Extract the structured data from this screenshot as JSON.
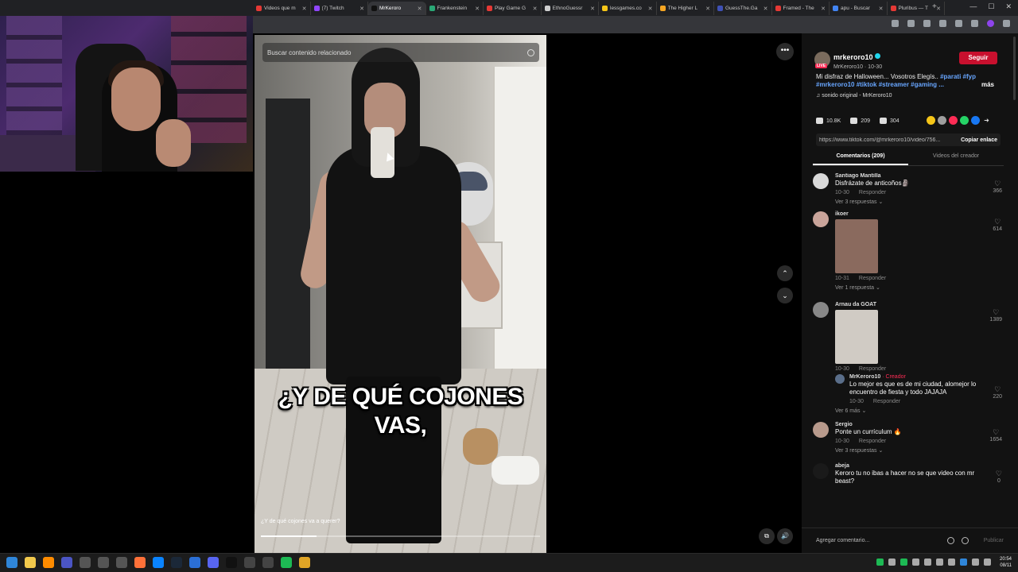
{
  "browser": {
    "tabs": [
      {
        "title": "Videos que m",
        "color": "#e53935"
      },
      {
        "title": "(7) Twitch",
        "color": "#9146ff"
      },
      {
        "title": "MrKeroro",
        "color": "#111111",
        "active": true
      },
      {
        "title": "Frankenstein",
        "color": "#2aa876"
      },
      {
        "title": "Play Game G",
        "color": "#e53935"
      },
      {
        "title": "EthnoGuessr",
        "color": "#cfcfcf"
      },
      {
        "title": "lessgames.co",
        "color": "#f5c518"
      },
      {
        "title": "The Higher L",
        "color": "#f5a623"
      },
      {
        "title": "GuessThe.Ga",
        "color": "#3f51b5"
      },
      {
        "title": "Framed - The",
        "color": "#e53935"
      },
      {
        "title": "apu - Buscar",
        "color": "#4285f4"
      },
      {
        "title": "Pluribus — T",
        "color": "#e53935"
      }
    ],
    "new_tab_icon": "+"
  },
  "video": {
    "search_placeholder": "Buscar contenido relacionado",
    "caption_line1": "¿Y DE QUÉ COJONES",
    "caption_line2": "VAS,",
    "subtitle": "¿Y de qué cojones va a querer?",
    "progress": 0.2
  },
  "author": {
    "name": "mrkeroro10",
    "handle_date": "MrKeroro10 · 10-30",
    "live_badge": "LIVE",
    "follow_label": "Seguir"
  },
  "description": {
    "text": "Mi disfraz de Halloween... Vosotros Elegís.. ",
    "tags_line1": "#parati #fyp",
    "tags_line2": "#mrkeroro10 #tiktok #streamer #gaming ...",
    "more": "más"
  },
  "sound": "♫  sonido original - MrKeroro10",
  "stats": {
    "likes": "10.8K",
    "comments": "209",
    "saves": "304"
  },
  "share_colors": [
    "#f5c518",
    "#9e9e9e",
    "#fe2c55",
    "#25d366",
    "#1877f2"
  ],
  "link": {
    "url": "https://www.tiktok.com/@mrkeroro10/video/756...",
    "copy": "Copiar enlace"
  },
  "comment_tabs": {
    "comments": "Comentarios (209)",
    "creator": "Videos del creador"
  },
  "comments": [
    {
      "user": "Santiago Mantilla",
      "text": "Disfrázate de anticoños🗿",
      "date": "10-30",
      "reply": "Responder",
      "likes": "366",
      "replies": "Ver 3 respuestas ⌄",
      "avatar": "#d9d9d9"
    },
    {
      "user": "ikoer",
      "text": "",
      "date": "10-31",
      "reply": "Responder",
      "likes": "614",
      "replies": "Ver 1 respuesta ⌄",
      "avatar": "#c9a49a",
      "image": "#8a6a5e"
    },
    {
      "user": "Arnau da GOAT",
      "text": "",
      "date": "10-30",
      "reply": "Responder",
      "likes": "1389",
      "replies": "",
      "avatar": "#888888",
      "image": "#d0cbc4"
    },
    {
      "user": "Sergio",
      "text": "Ponte un currículum 🔥",
      "date": "10-30",
      "reply": "Responder",
      "likes": "1654",
      "replies": "Ver 3 respuestas ⌄",
      "avatar": "#b89a8c"
    },
    {
      "user": "abeja",
      "text": "Keroro tu no ibas a hacer no se que video con mr beast?",
      "date": "",
      "reply": "",
      "likes": "0",
      "replies": "",
      "avatar": "#1a1a1a"
    }
  ],
  "creator_reply": {
    "user": "MrKeroro10",
    "badge": "· Creador",
    "text": "Lo mejor es que es de mi ciudad, alomejor lo encuentro de fiesta y todo JAJAJA",
    "date": "10-30",
    "reply": "Responder",
    "likes": "220",
    "more": "Ver 6 más ⌄"
  },
  "add_comment": {
    "placeholder": "Agregar comentario...",
    "publish": "Publicar"
  },
  "clock": {
    "time": "20:54",
    "date": "08/11"
  }
}
